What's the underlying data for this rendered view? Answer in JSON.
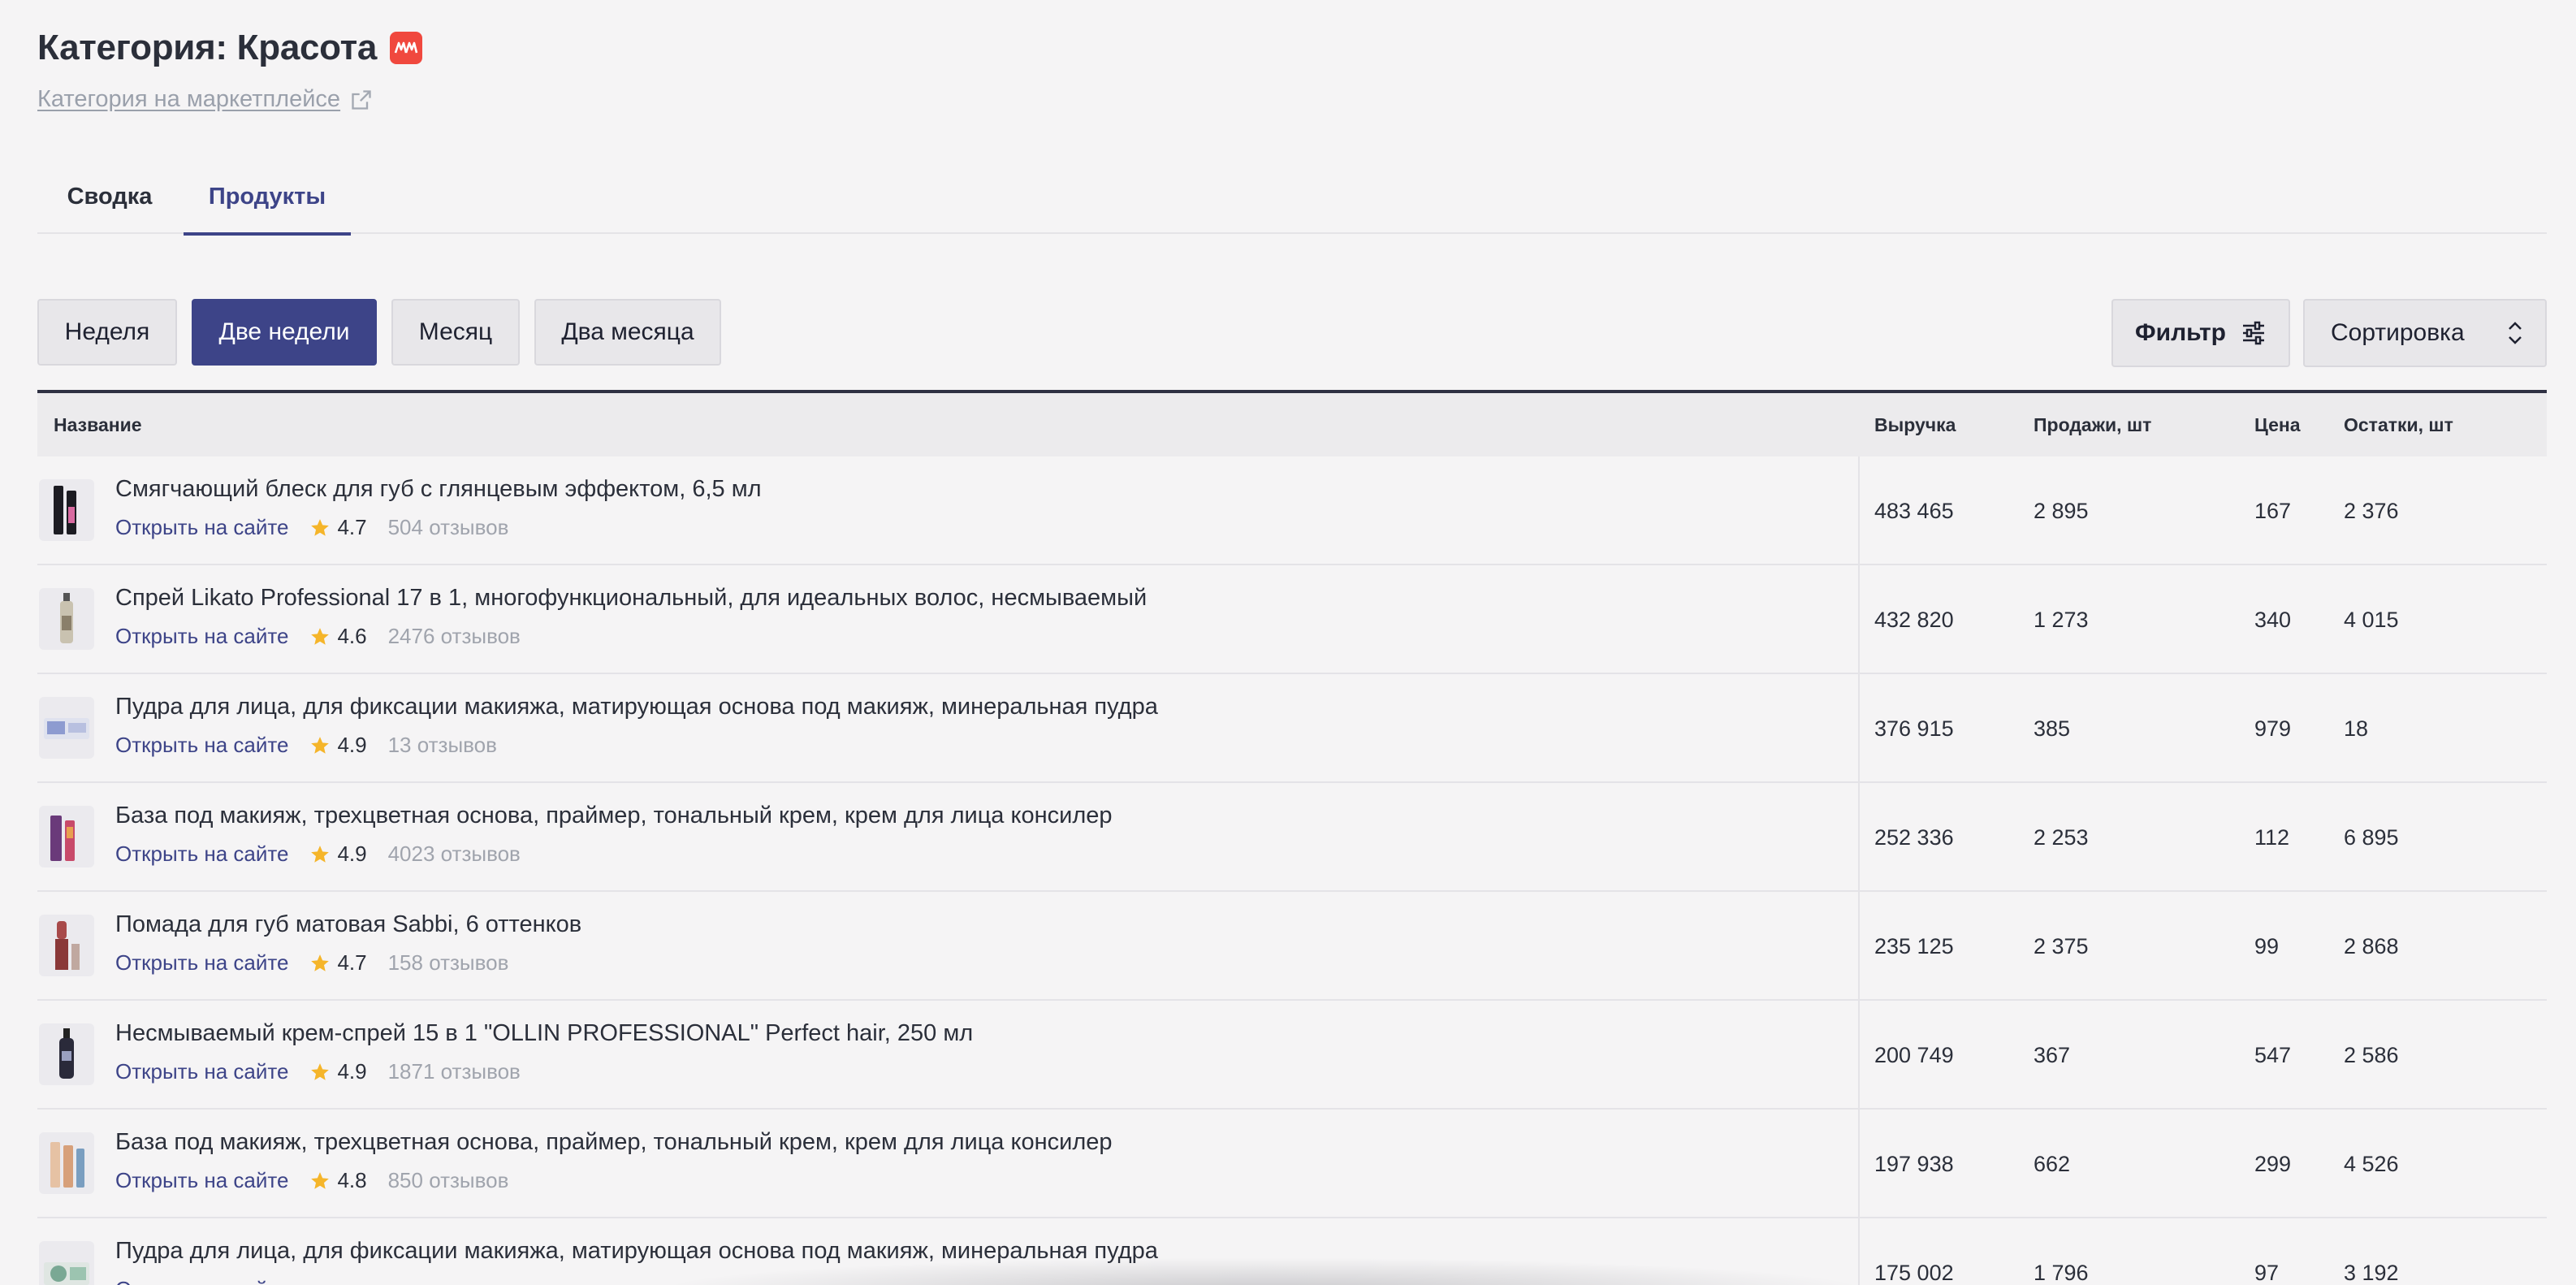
{
  "header": {
    "title": "Категория: Красота",
    "badge_icon": "megamarket-logo",
    "marketplace_link": "Категория на маркетплейсе"
  },
  "tabs": [
    {
      "label": "Сводка",
      "active": false
    },
    {
      "label": "Продукты",
      "active": true
    }
  ],
  "periods": [
    {
      "label": "Неделя",
      "active": false
    },
    {
      "label": "Две недели",
      "active": true
    },
    {
      "label": "Месяц",
      "active": false
    },
    {
      "label": "Два месяца",
      "active": false
    }
  ],
  "controls": {
    "filter_label": "Фильтр",
    "sort_label": "Сортировка"
  },
  "table": {
    "columns": [
      "Название",
      "Выручка",
      "Продажи, шт",
      "Цена",
      "Остатки, шт"
    ],
    "open_link_label": "Открыть на сайте",
    "rows": [
      {
        "name": "Смягчающий блеск для губ с глянцевым эффектом, 6,5 мл",
        "rating": "4.7",
        "reviews": "504 отзывов",
        "revenue": "483 465",
        "sales": "2 895",
        "price": "167",
        "stock": "2 376",
        "thumb": "lip-gloss"
      },
      {
        "name": "Спрей Likato Professional 17 в 1, многофункциональный, для идеальных волос, несмываемый",
        "rating": "4.6",
        "reviews": "2476 отзывов",
        "revenue": "432 820",
        "sales": "1 273",
        "price": "340",
        "stock": "4 015",
        "thumb": "spray-bottle"
      },
      {
        "name": "Пудра для лица, для фиксации макияжа, матирующая основа под макияж, минеральная пудра",
        "rating": "4.9",
        "reviews": "13 отзывов",
        "revenue": "376 915",
        "sales": "385",
        "price": "979",
        "stock": "18",
        "thumb": "powder-box"
      },
      {
        "name": "База под макияж, трехцветная основа, праймер, тональный крем, крем для лица консилер",
        "rating": "4.9",
        "reviews": "4023 отзывов",
        "revenue": "252 336",
        "sales": "2 253",
        "price": "112",
        "stock": "6 895",
        "thumb": "primer-bottles"
      },
      {
        "name": "Помада для губ матовая Sabbi, 6 оттенков",
        "rating": "4.7",
        "reviews": "158 отзывов",
        "revenue": "235 125",
        "sales": "2 375",
        "price": "99",
        "stock": "2 868",
        "thumb": "lipstick"
      },
      {
        "name": "Несмываемый крем-спрей 15 в 1 \"OLLIN PROFESSIONAL\" Perfect hair, 250 мл",
        "rating": "4.9",
        "reviews": "1871 отзывов",
        "revenue": "200 749",
        "sales": "367",
        "price": "547",
        "stock": "2 586",
        "thumb": "dark-spray"
      },
      {
        "name": "База под макияж, трехцветная основа, праймер, тональный крем, крем для лица консилер",
        "rating": "4.8",
        "reviews": "850 отзывов",
        "revenue": "197 938",
        "sales": "662",
        "price": "299",
        "stock": "4 526",
        "thumb": "primer-tubes"
      },
      {
        "name": "Пудра для лица, для фиксации макияжа, матирующая основа под макияж, минеральная пудра",
        "rating": "",
        "reviews": "",
        "revenue": "175 002",
        "sales": "1 796",
        "price": "97",
        "stock": "3 192",
        "thumb": "powder-box-green"
      }
    ]
  },
  "colors": {
    "accent": "#3d4488",
    "badge": "#f0483e",
    "star": "#f5b52a",
    "background": "#f5f4f5"
  }
}
